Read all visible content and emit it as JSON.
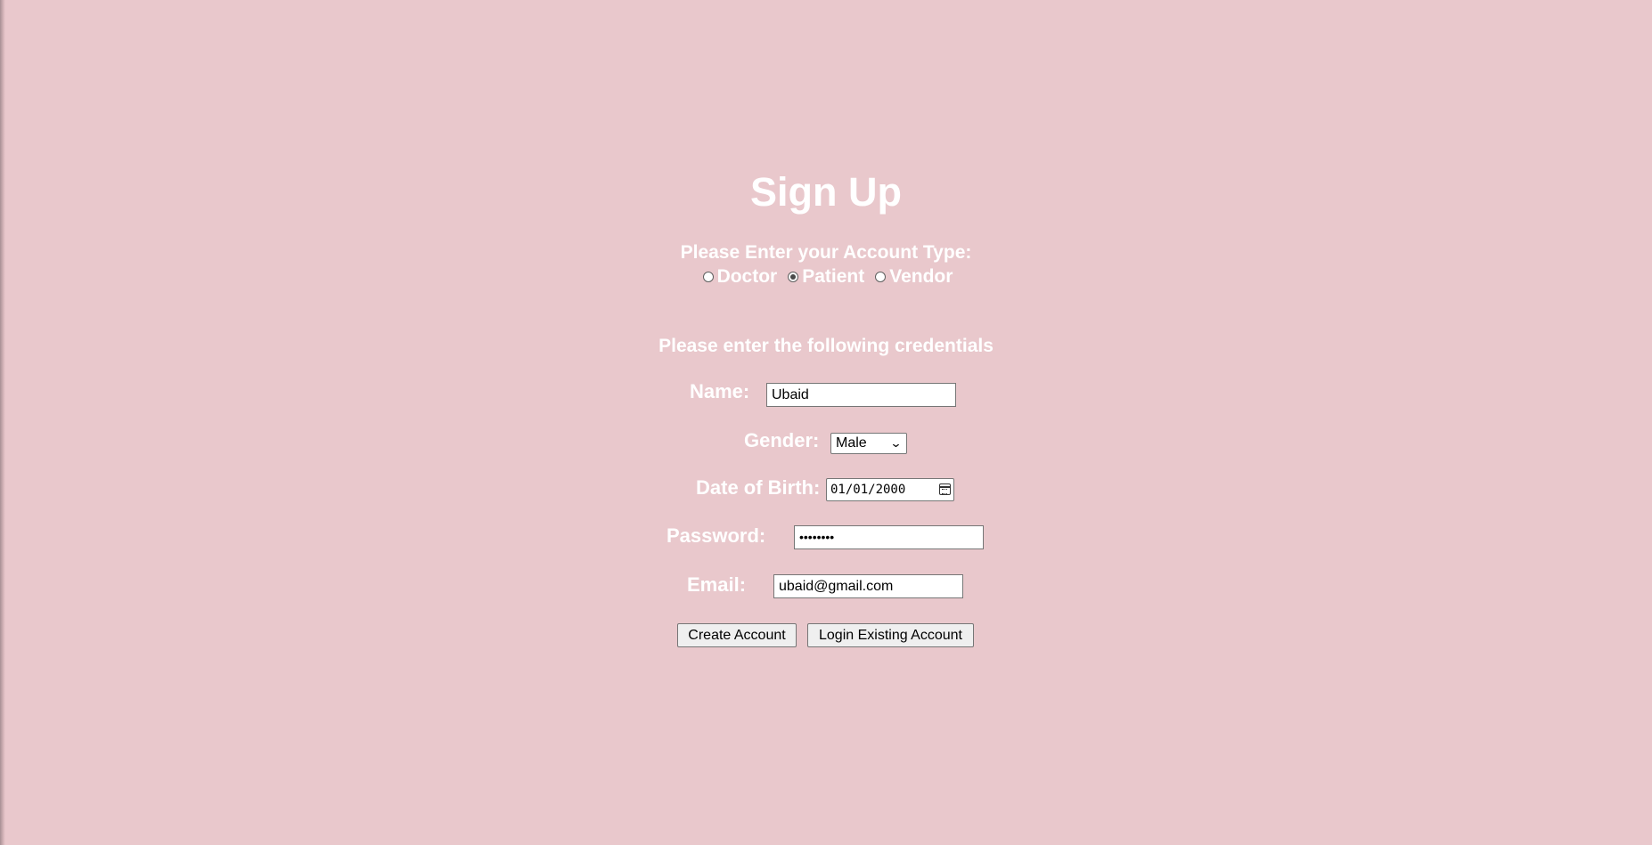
{
  "title": "Sign Up",
  "account_type": {
    "label": "Please Enter your Account Type:",
    "options": [
      {
        "label": "Doctor",
        "checked": false
      },
      {
        "label": "Patient",
        "checked": true
      },
      {
        "label": "Vendor",
        "checked": false
      }
    ]
  },
  "credentials_heading": "Please enter the following credentials",
  "fields": {
    "name": {
      "label": "Name:",
      "value": "Ubaid"
    },
    "gender": {
      "label": "Gender:",
      "value": "Male"
    },
    "dob": {
      "label": "Date of Birth:",
      "value": "01/01/2000"
    },
    "password": {
      "label": "Password:",
      "value": "••••••••"
    },
    "email": {
      "label": "Email:",
      "value": "ubaid@gmail.com"
    }
  },
  "buttons": {
    "create": "Create Account",
    "login": "Login Existing Account"
  },
  "colors": {
    "background": "#e9c8cc",
    "text": "#ffffff"
  }
}
